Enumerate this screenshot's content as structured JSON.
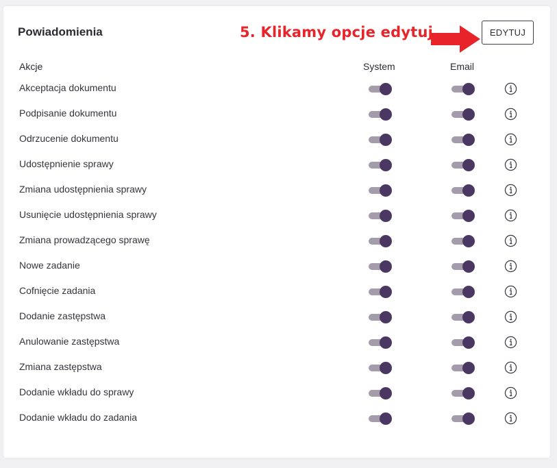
{
  "card": {
    "title": "Powiadomienia",
    "annotation": "5. Klikamy opcje edytuj",
    "edit_label": "EDYTUJ"
  },
  "columns": {
    "actions": "Akcje",
    "system": "System",
    "email": "Email"
  },
  "colors": {
    "accent": "#4b3862",
    "track": "#a49cab",
    "annotation": "#e8232a"
  },
  "icons": {
    "info": "info-icon",
    "arrow": "arrow-right-icon"
  },
  "rows": [
    {
      "label": "Akceptacja dokumentu",
      "system": true,
      "email": true
    },
    {
      "label": "Podpisanie dokumentu",
      "system": true,
      "email": true
    },
    {
      "label": "Odrzucenie dokumentu",
      "system": true,
      "email": true
    },
    {
      "label": "Udostępnienie sprawy",
      "system": true,
      "email": true
    },
    {
      "label": "Zmiana udostępnienia sprawy",
      "system": true,
      "email": true
    },
    {
      "label": "Usunięcie udostępnienia sprawy",
      "system": true,
      "email": true
    },
    {
      "label": "Zmiana prowadzącego sprawę",
      "system": true,
      "email": true
    },
    {
      "label": "Nowe zadanie",
      "system": true,
      "email": true
    },
    {
      "label": "Cofnięcie zadania",
      "system": true,
      "email": true
    },
    {
      "label": "Dodanie zastępstwa",
      "system": true,
      "email": true
    },
    {
      "label": "Anulowanie zastępstwa",
      "system": true,
      "email": true
    },
    {
      "label": "Zmiana zastępstwa",
      "system": true,
      "email": true
    },
    {
      "label": "Dodanie wkładu do sprawy",
      "system": true,
      "email": true
    },
    {
      "label": "Dodanie wkładu do zadania",
      "system": true,
      "email": true
    }
  ]
}
